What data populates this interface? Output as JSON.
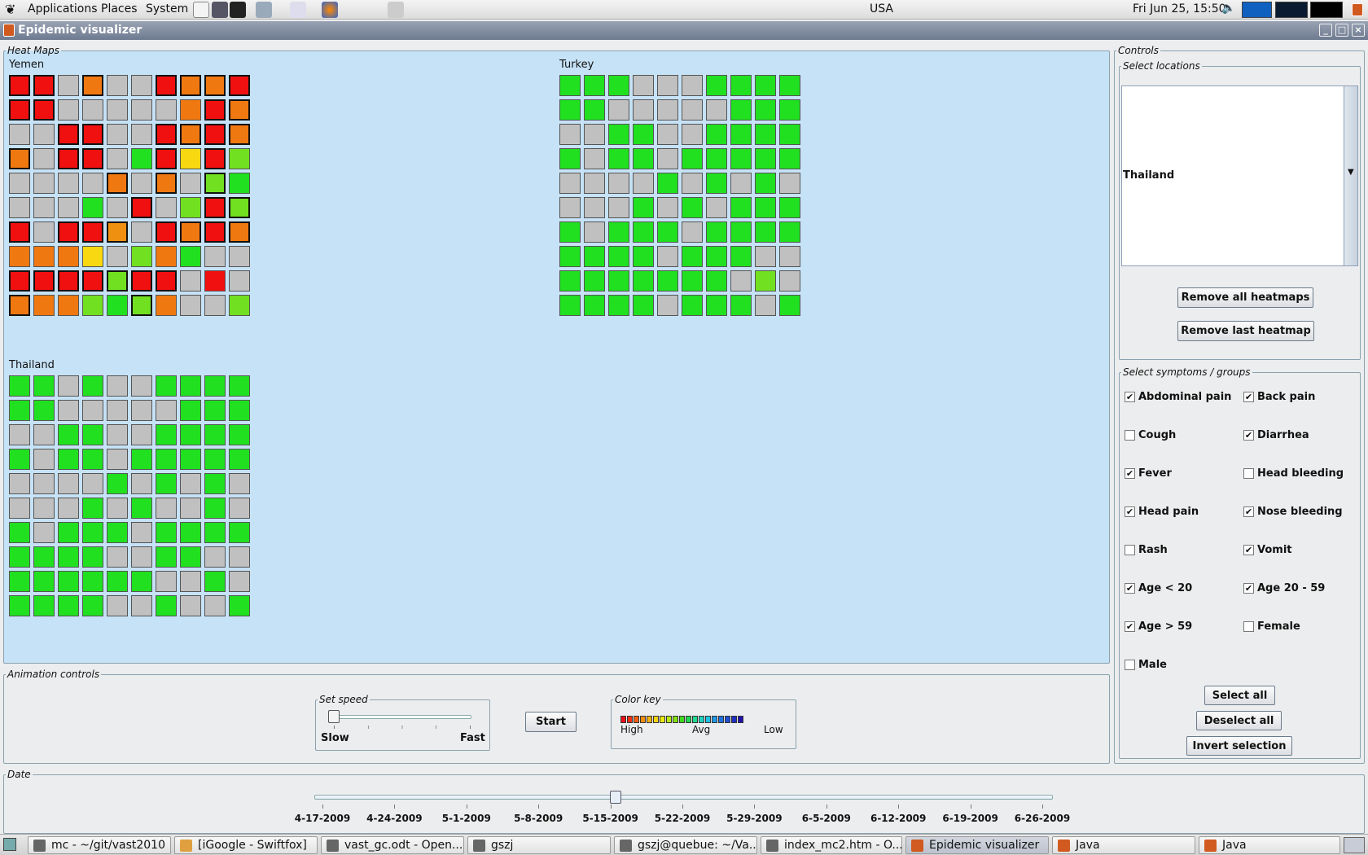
{
  "top_panel": {
    "menus": [
      "Applications",
      "Places",
      "System"
    ],
    "locale": "USA",
    "clock": "Fri Jun 25, 15:50"
  },
  "window": {
    "title": "Epidemic visualizer",
    "buttons": [
      "minimize",
      "maximize",
      "close"
    ]
  },
  "heatmaps": {
    "legend": "Heat Maps",
    "maps": [
      {
        "name": "Yemen",
        "cells": [
          "RRGOGGROOR",
          "RRGGGGGORO",
          "GGRRGGRORO",
          "OGRRGgRYRl",
          "GGGGOGOGlg",
          "GGGgGRGlRl",
          "RGRRIGRORO",
          "OOOYGlOgGG",
          "RRRRlRRGRG",
          "OOOlglOGGl"
        ],
        "bold_rows": [
          [
            1,
            1,
            0,
            1,
            0,
            0,
            1,
            1,
            1,
            1
          ],
          [
            1,
            1,
            0,
            0,
            0,
            0,
            0,
            0,
            1,
            1
          ],
          [
            0,
            0,
            1,
            1,
            0,
            0,
            1,
            1,
            1,
            1
          ],
          [
            1,
            0,
            1,
            1,
            0,
            0,
            1,
            0,
            1,
            0
          ],
          [
            0,
            0,
            0,
            0,
            1,
            0,
            1,
            0,
            1,
            0
          ],
          [
            0,
            0,
            0,
            0,
            0,
            1,
            0,
            0,
            1,
            1
          ],
          [
            1,
            0,
            1,
            1,
            1,
            0,
            1,
            1,
            1,
            1
          ],
          [
            0,
            0,
            0,
            0,
            0,
            0,
            0,
            0,
            0,
            0
          ],
          [
            1,
            1,
            1,
            1,
            1,
            1,
            1,
            0,
            0,
            0
          ],
          [
            1,
            0,
            0,
            0,
            0,
            1,
            0,
            0,
            0,
            0
          ]
        ]
      },
      {
        "name": "Turkey",
        "cells": [
          "gggGGGgggg",
          "ggGGGGGggg",
          "GGggGGgggg",
          "gGggGggggg",
          "GGGGgGgGgG",
          "GGGgGgGggg",
          "gGgggGgggg",
          "ggggGgggGG",
          "gggggggGlG",
          "ggggGgggGg"
        ],
        "bold_rows": []
      },
      {
        "name": "Thailand",
        "cells": [
          "ggGgGGgggg",
          "ggGGGGGggg",
          "GGggGGgggg",
          "gGggGggggg",
          "GGGGgGgGgG",
          "GGGgGgGGgG",
          "gGgggGgggg",
          "ggggGGggGG",
          "ggggggGGgG",
          "ggggGGgGGg"
        ],
        "bold_rows": []
      }
    ]
  },
  "controls": {
    "legend": "Controls",
    "select_locations": {
      "legend": "Select locations",
      "selected": "Thailand"
    },
    "remove_all_label": "Remove all heatmaps",
    "remove_last_label": "Remove last heatmap",
    "symptoms": {
      "legend": "Select symptoms / groups",
      "items": [
        {
          "label": "Abdominal pain",
          "checked": true
        },
        {
          "label": "Back pain",
          "checked": true
        },
        {
          "label": "Cough",
          "checked": false
        },
        {
          "label": "Diarrhea",
          "checked": true
        },
        {
          "label": "Fever",
          "checked": true
        },
        {
          "label": "Head bleeding",
          "checked": false
        },
        {
          "label": "Head pain",
          "checked": true
        },
        {
          "label": "Nose bleeding",
          "checked": true
        },
        {
          "label": "Rash",
          "checked": false
        },
        {
          "label": "Vomit",
          "checked": true
        },
        {
          "label": "Age < 20",
          "checked": true
        },
        {
          "label": "Age 20 - 59",
          "checked": true
        },
        {
          "label": "Age > 59",
          "checked": true
        },
        {
          "label": "Female",
          "checked": false
        },
        {
          "label": "Male",
          "checked": false
        }
      ]
    },
    "select_all_label": "Select all",
    "deselect_all_label": "Deselect all",
    "invert_label": "Invert selection"
  },
  "animation": {
    "legend": "Animation controls",
    "speed_legend": "Set speed",
    "slow_label": "Slow",
    "fast_label": "Fast",
    "speed_value": 0,
    "start_label": "Start",
    "colorkey_legend": "Color key",
    "key_high": "High",
    "key_avg": "Avg",
    "key_low": "Low",
    "key_colors": [
      "#e8101a",
      "#f03010",
      "#f06010",
      "#f08c10",
      "#f0b010",
      "#f0d010",
      "#e8e810",
      "#b8e810",
      "#80e010",
      "#40d820",
      "#20d850",
      "#20d890",
      "#20d0c0",
      "#20c0e0",
      "#2098e8",
      "#2070e0",
      "#2050d0",
      "#2030c0",
      "#2010b0"
    ]
  },
  "date": {
    "legend": "Date",
    "ticks": [
      "4-17-2009",
      "4-24-2009",
      "5-1-2009",
      "5-8-2009",
      "5-15-2009",
      "5-22-2009",
      "5-29-2009",
      "6-5-2009",
      "6-12-2009",
      "6-19-2009",
      "6-26-2009"
    ],
    "value_fraction": 0.408
  },
  "palette": {
    "R": "#f01010",
    "O": "#f07810",
    "o": "#f8a000",
    "Y": "#f8d810",
    "G": "#c0c0c0",
    "g": "#20e020",
    "l": "#70e020",
    "I": "#f09010"
  },
  "taskbar": {
    "tasks": [
      {
        "label": "mc - ~/git/vast2010"
      },
      {
        "label": "[iGoogle - Swiftfox]"
      },
      {
        "label": "vast_gc.odt - Open..."
      },
      {
        "label": "gszj"
      },
      {
        "label": "gszj@quebue: ~/Va..."
      },
      {
        "label": "index_mc2.htm - O..."
      },
      {
        "label": "Epidemic visualizer"
      },
      {
        "label": "Java"
      },
      {
        "label": "Java"
      }
    ]
  }
}
